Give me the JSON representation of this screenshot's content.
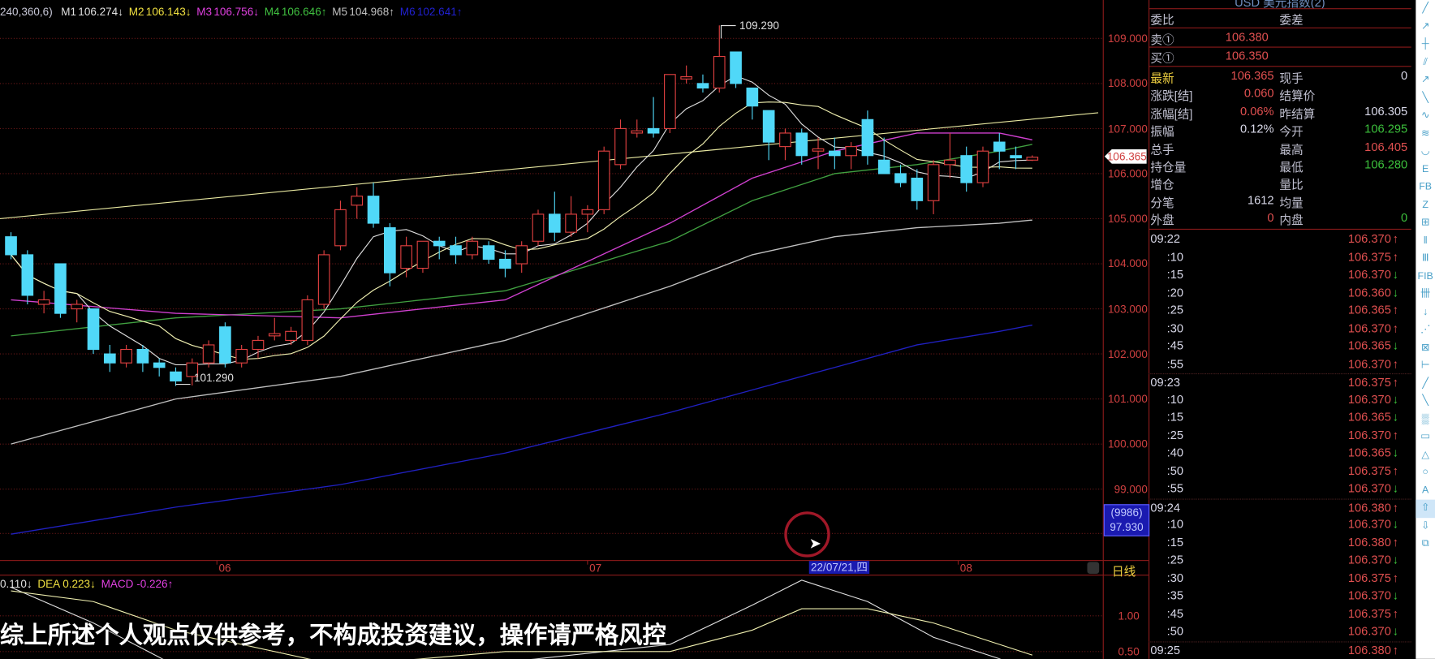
{
  "header": {
    "params": "240,360,6)",
    "ma": [
      {
        "label": "M1",
        "value": "106.274",
        "dir": "↓",
        "color": "#e0e0e0"
      },
      {
        "label": "M2",
        "value": "106.143",
        "dir": "↓",
        "color": "#f0e040"
      },
      {
        "label": "M3",
        "value": "106.756",
        "dir": "↓",
        "color": "#e040e0"
      },
      {
        "label": "M4",
        "value": "106.646",
        "dir": "↑",
        "color": "#40c040"
      },
      {
        "label": "M5",
        "value": "104.968",
        "dir": "↑",
        "color": "#c0c0c0"
      },
      {
        "label": "M6",
        "value": "102.641",
        "dir": "↑",
        "color": "#2020d0"
      }
    ]
  },
  "chart_data": {
    "type": "candlestick",
    "price_ticks": [
      "109.000",
      "108.000",
      "107.000",
      "106.000",
      "105.000",
      "104.000",
      "103.000",
      "102.000",
      "101.000",
      "100.000",
      "99.000"
    ],
    "ylim": [
      97.6,
      109.85
    ],
    "x_ticks": [
      {
        "label": "06",
        "index": 12.5
      },
      {
        "label": "07",
        "index": 35
      },
      {
        "label": "08",
        "index": 57.5
      }
    ],
    "high_label": "109.290",
    "low_label": "101.290",
    "last_price": "106.365",
    "cursor_value": {
      "count": "(9986)",
      "price": "97.930"
    },
    "cursor_date": "22/07/21,四",
    "period": "日线",
    "candles": [
      [
        104.6,
        104.7,
        104.1,
        104.2
      ],
      [
        104.2,
        104.3,
        103.1,
        103.3
      ],
      [
        103.1,
        103.4,
        102.9,
        103.2
      ],
      [
        104.0,
        104.0,
        102.8,
        102.9
      ],
      [
        103.0,
        103.2,
        102.7,
        103.1
      ],
      [
        103.0,
        103.0,
        102.0,
        102.1
      ],
      [
        102.0,
        102.2,
        101.6,
        101.8
      ],
      [
        101.8,
        102.2,
        101.7,
        102.1
      ],
      [
        102.1,
        102.2,
        101.6,
        101.8
      ],
      [
        101.8,
        101.9,
        101.5,
        101.7
      ],
      [
        101.6,
        101.7,
        101.29,
        101.4
      ],
      [
        101.5,
        101.9,
        101.3,
        101.8
      ],
      [
        101.8,
        102.3,
        101.7,
        102.2
      ],
      [
        102.6,
        102.7,
        101.7,
        101.8
      ],
      [
        101.8,
        102.2,
        101.7,
        102.1
      ],
      [
        102.1,
        102.4,
        101.9,
        102.3
      ],
      [
        102.4,
        102.8,
        102.3,
        102.45
      ],
      [
        102.3,
        102.6,
        102.2,
        102.5
      ],
      [
        102.3,
        103.3,
        102.2,
        103.2
      ],
      [
        103.1,
        104.3,
        103.0,
        104.2
      ],
      [
        104.4,
        105.4,
        104.3,
        105.2
      ],
      [
        105.3,
        105.7,
        105.0,
        105.5
      ],
      [
        105.5,
        105.8,
        104.8,
        104.9
      ],
      [
        104.8,
        104.9,
        103.5,
        103.8
      ],
      [
        103.9,
        104.6,
        103.7,
        104.4
      ],
      [
        103.9,
        104.5,
        103.8,
        104.5
      ],
      [
        104.5,
        104.6,
        104.1,
        104.4
      ],
      [
        104.4,
        104.6,
        104.0,
        104.2
      ],
      [
        104.2,
        104.6,
        104.1,
        104.5
      ],
      [
        104.4,
        104.5,
        104.0,
        104.1
      ],
      [
        104.1,
        104.3,
        103.7,
        103.9
      ],
      [
        104.0,
        104.5,
        103.8,
        104.4
      ],
      [
        104.5,
        105.2,
        104.4,
        105.1
      ],
      [
        105.1,
        105.6,
        104.5,
        104.7
      ],
      [
        104.7,
        105.5,
        104.6,
        105.1
      ],
      [
        105.1,
        105.3,
        104.7,
        105.2
      ],
      [
        105.2,
        106.6,
        105.1,
        106.5
      ],
      [
        106.2,
        107.2,
        106.1,
        107.0
      ],
      [
        106.9,
        107.2,
        106.8,
        106.95
      ],
      [
        107.0,
        107.7,
        106.8,
        106.9
      ],
      [
        107.0,
        108.2,
        106.9,
        108.2
      ],
      [
        108.1,
        108.4,
        108.0,
        108.15
      ],
      [
        108.0,
        108.2,
        107.8,
        107.9
      ],
      [
        107.9,
        109.29,
        107.8,
        108.6
      ],
      [
        108.7,
        108.7,
        107.9,
        108.0
      ],
      [
        107.9,
        107.9,
        107.2,
        107.5
      ],
      [
        107.4,
        107.4,
        106.3,
        106.7
      ],
      [
        106.6,
        107.0,
        106.3,
        106.9
      ],
      [
        106.9,
        107.0,
        106.2,
        106.4
      ],
      [
        106.5,
        106.8,
        106.1,
        106.55
      ],
      [
        106.5,
        106.8,
        106.1,
        106.4
      ],
      [
        106.4,
        106.7,
        106.1,
        106.6
      ],
      [
        107.2,
        107.4,
        106.2,
        106.4
      ],
      [
        106.3,
        106.8,
        106.0,
        106.0
      ],
      [
        106.0,
        106.2,
        105.7,
        105.8
      ],
      [
        105.9,
        106.1,
        105.2,
        105.4
      ],
      [
        105.4,
        106.3,
        105.1,
        106.2
      ],
      [
        106.2,
        106.9,
        105.9,
        106.3
      ],
      [
        106.4,
        106.6,
        105.6,
        105.8
      ],
      [
        105.8,
        106.6,
        105.7,
        106.5
      ],
      [
        106.7,
        106.9,
        106.1,
        106.5
      ],
      [
        106.4,
        106.6,
        106.1,
        106.35
      ],
      [
        106.3,
        106.405,
        106.28,
        106.365
      ]
    ],
    "ma_lines": {
      "index": [
        0,
        10,
        20,
        30,
        40,
        45,
        50,
        55,
        60,
        62
      ],
      "M3": [
        103.2,
        102.9,
        102.8,
        103.2,
        104.9,
        105.9,
        106.5,
        106.9,
        106.9,
        106.75
      ],
      "M4": [
        102.4,
        102.8,
        103.0,
        103.4,
        104.5,
        105.4,
        106.0,
        106.2,
        106.5,
        106.65
      ],
      "M5": [
        100.0,
        101.0,
        101.5,
        102.3,
        103.5,
        104.2,
        104.6,
        104.8,
        104.9,
        104.97
      ],
      "M6": [
        98.0,
        98.6,
        99.1,
        99.8,
        100.7,
        101.2,
        101.7,
        102.2,
        102.5,
        102.64
      ]
    },
    "trend_line": {
      "from": [
        -0.7,
        105.0
      ],
      "to": [
        66,
        107.35
      ],
      "color": "#e8e8a0"
    },
    "colors": {
      "up": "#e04040",
      "down": "#50d8f8",
      "M1": "#e0e0e0",
      "M2": "#f0f0b0",
      "M3": "#d040d0",
      "M4": "#40a040",
      "M5": "#c0c0c0",
      "M6": "#2020c0"
    },
    "macd": {
      "header": [
        {
          "text": "0.110↓",
          "color": "#e0e0e0"
        },
        {
          "text": "DEA 0.223↓",
          "color": "#f0e040"
        },
        {
          "text": "MACD -0.226↑",
          "color": "#e040e0"
        }
      ],
      "ticks": [
        "1.00",
        "0.50"
      ],
      "index": [
        0,
        5,
        10,
        20,
        30,
        40,
        45,
        48,
        52,
        56,
        60,
        62
      ],
      "DIF": [
        1.4,
        0.9,
        0.3,
        0.1,
        0.35,
        0.6,
        1.15,
        1.5,
        1.2,
        0.7,
        0.4,
        0.2
      ],
      "DEA": [
        1.35,
        1.2,
        0.8,
        0.3,
        0.5,
        0.5,
        0.8,
        1.1,
        1.1,
        0.9,
        0.6,
        0.45
      ]
    }
  },
  "quote": {
    "title": "USD 美元指数(2)",
    "weibi": "委比",
    "weicha": "委差",
    "sell": {
      "label": "卖①",
      "price": "106.380"
    },
    "buy": {
      "label": "买①",
      "price": "106.350"
    },
    "rows": [
      {
        "l": "最新",
        "v": "106.365",
        "vc": "red",
        "l2": "现手",
        "v2": "0",
        "v2c": "wht",
        "lc": "yel"
      },
      {
        "l": "涨跌[结]",
        "v": "0.060",
        "vc": "red",
        "l2": "结算价",
        "v2": "",
        "v2c": "wht"
      },
      {
        "l": "涨幅[结]",
        "v": "0.06%",
        "vc": "red",
        "l2": "昨结算",
        "v2": "106.305",
        "v2c": "wht"
      },
      {
        "l": "振幅",
        "v": "0.12%",
        "vc": "wht",
        "l2": "今开",
        "v2": "106.295",
        "v2c": "grn"
      },
      {
        "l": "总手",
        "v": "",
        "vc": "wht",
        "l2": "最高",
        "v2": "106.405",
        "v2c": "red"
      },
      {
        "l": "持仓量",
        "v": "",
        "vc": "wht",
        "l2": "最低",
        "v2": "106.280",
        "v2c": "grn"
      },
      {
        "l": "增仓",
        "v": "",
        "vc": "wht",
        "l2": "量比",
        "v2": "",
        "v2c": "wht"
      },
      {
        "l": "分笔",
        "v": "1612",
        "vc": "wht",
        "l2": "均量",
        "v2": "",
        "v2c": "wht"
      },
      {
        "l": "外盘",
        "v": "0",
        "vc": "red",
        "l2": "内盘",
        "v2": "0",
        "v2c": "grn"
      }
    ]
  },
  "ticks": [
    [
      "09:22",
      "106.370",
      "↑"
    ],
    [
      ":10",
      "106.375",
      "↑"
    ],
    [
      ":15",
      "106.370",
      "↓"
    ],
    [
      ":20",
      "106.360",
      "↓"
    ],
    [
      ":25",
      "106.365",
      "↑"
    ],
    [
      ":30",
      "106.370",
      "↑"
    ],
    [
      ":45",
      "106.365",
      "↓"
    ],
    [
      ":55",
      "106.370",
      "↑"
    ],
    [
      "09:23",
      "106.375",
      "↑"
    ],
    [
      ":10",
      "106.370",
      "↓"
    ],
    [
      ":15",
      "106.365",
      "↓"
    ],
    [
      ":25",
      "106.370",
      "↑"
    ],
    [
      ":40",
      "106.365",
      "↓"
    ],
    [
      ":50",
      "106.375",
      "↑"
    ],
    [
      ":55",
      "106.370",
      "↓"
    ],
    [
      "09:24",
      "106.380",
      "↑"
    ],
    [
      ":10",
      "106.370",
      "↓"
    ],
    [
      ":15",
      "106.380",
      "↑"
    ],
    [
      ":25",
      "106.370",
      "↓"
    ],
    [
      ":30",
      "106.375",
      "↑"
    ],
    [
      ":35",
      "106.370",
      "↓"
    ],
    [
      ":45",
      "106.375",
      "↑"
    ],
    [
      ":50",
      "106.370",
      "↓"
    ],
    [
      "09:25",
      "106.380",
      "↑"
    ]
  ],
  "toolbar": [
    "line-icon",
    "ray-icon",
    "horizontal-line-icon",
    "parallel-line-icon",
    "arrow-line-icon",
    "zigzag-icon",
    "wave-icon",
    "wave2-icon",
    "arc-icon",
    "fib-extension-icon",
    "fib-icon",
    "fib-time-icon",
    "gann-icon",
    "arrow-down-line-icon",
    "fan-icon",
    "gann-box-icon",
    "channel-icon",
    "up-line-icon",
    "down-line-icon",
    "cross-hatch-icon",
    "rectangle-icon",
    "triangle-icon",
    "ellipse-icon",
    "text-icon",
    "up-arrow-icon",
    "down-arrow-icon",
    "copy-icon",
    "lock-icon",
    "draw-icon",
    "eraser-icon",
    "palette-icon"
  ],
  "toolbar_glyphs": [
    "╱",
    "↗",
    "┼",
    "⫽",
    "↗",
    "╲",
    "∿",
    "≋",
    "◡",
    "E",
    "FB",
    "Z",
    "⊞",
    "ǁ",
    "Ⅲ",
    "FIB",
    "卌",
    "↓",
    "⋰",
    "⊠",
    "⊢",
    "╱",
    "╲",
    "▒",
    "▭",
    "△",
    "○",
    "A",
    "⇧",
    "⇩",
    "⧉"
  ],
  "subtitle": "综上所述个人观点仅供参考，不构成投资建议，操作请严格风控"
}
